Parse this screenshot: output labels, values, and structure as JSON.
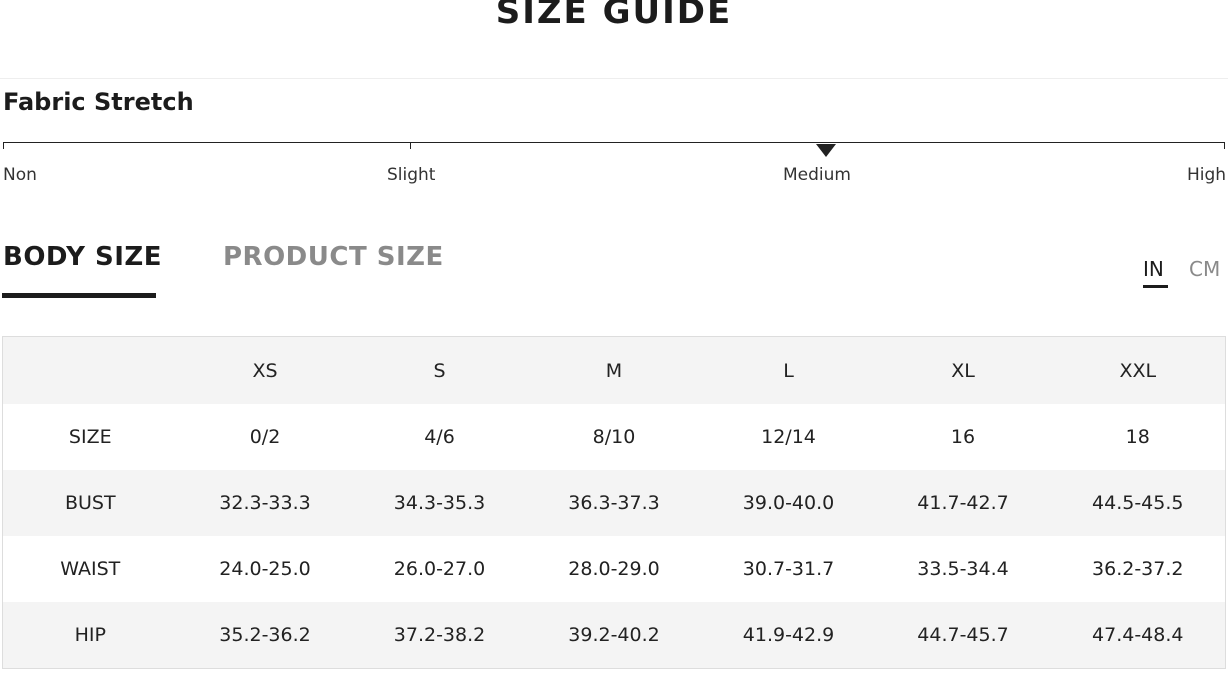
{
  "title": "SIZE GUIDE",
  "fabric_stretch": {
    "heading": "Fabric Stretch",
    "levels": [
      "Non",
      "Slight",
      "Medium",
      "High"
    ],
    "selected": "Medium"
  },
  "tabs": [
    {
      "label": "BODY SIZE",
      "active": true
    },
    {
      "label": "PRODUCT SIZE",
      "active": false
    }
  ],
  "units": [
    {
      "label": "IN",
      "active": true
    },
    {
      "label": "CM",
      "active": false
    }
  ],
  "size_table": {
    "columns": [
      "",
      "XS",
      "S",
      "M",
      "L",
      "XL",
      "XXL"
    ],
    "rows": [
      {
        "label": "SIZE",
        "values": [
          "0/2",
          "4/6",
          "8/10",
          "12/14",
          "16",
          "18"
        ]
      },
      {
        "label": "BUST",
        "values": [
          "32.3-33.3",
          "34.3-35.3",
          "36.3-37.3",
          "39.0-40.0",
          "41.7-42.7",
          "44.5-45.5"
        ]
      },
      {
        "label": "WAIST",
        "values": [
          "24.0-25.0",
          "26.0-27.0",
          "28.0-29.0",
          "30.7-31.7",
          "33.5-34.4",
          "36.2-37.2"
        ]
      },
      {
        "label": "HIP",
        "values": [
          "35.2-36.2",
          "37.2-38.2",
          "39.2-40.2",
          "41.9-42.9",
          "44.7-45.7",
          "47.4-48.4"
        ]
      }
    ]
  },
  "colors": {
    "text": "#222222",
    "inactive": "#8a8a8a",
    "row_shade": "#f4f4f4"
  }
}
